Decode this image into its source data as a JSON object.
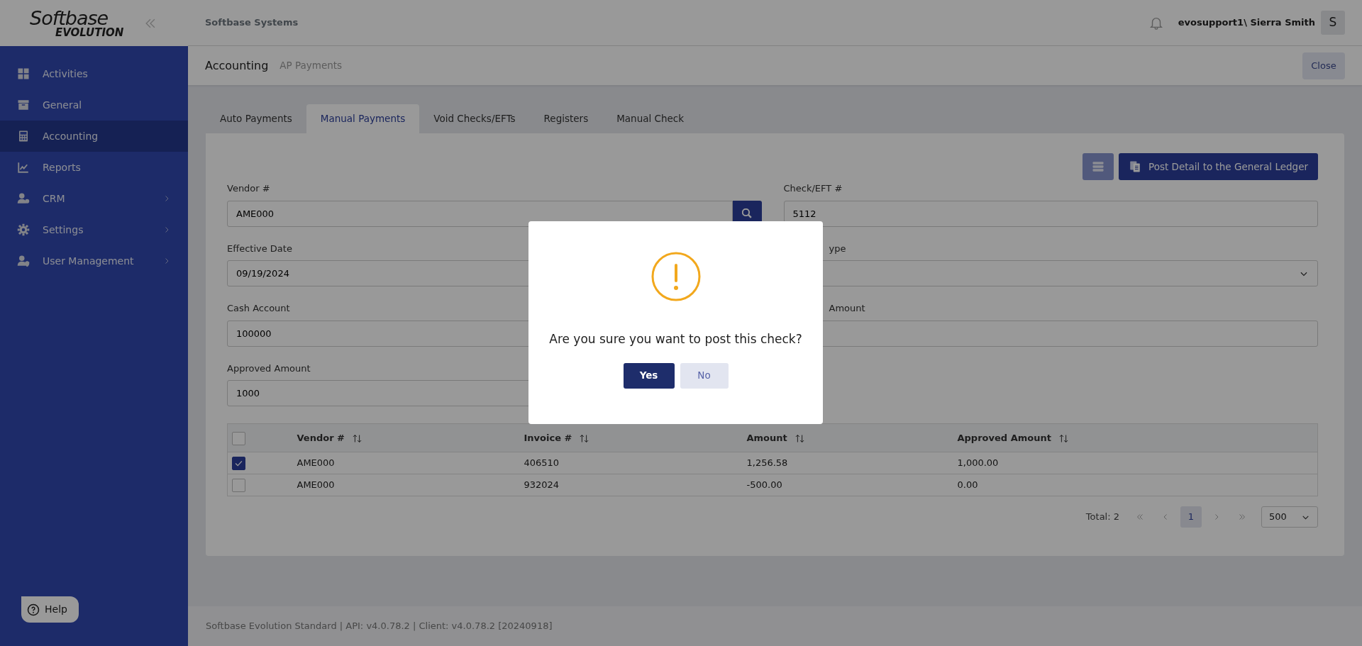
{
  "sidebar": {
    "logo": {
      "line_1": "Softbase",
      "line_2": "EVOLUTION"
    },
    "items": [
      {
        "label": "Activities",
        "selected": false,
        "expandable": false
      },
      {
        "label": "General",
        "selected": false,
        "expandable": false
      },
      {
        "label": "Accounting",
        "selected": true,
        "expandable": false
      },
      {
        "label": "Reports",
        "selected": false,
        "expandable": false
      },
      {
        "label": "CRM",
        "selected": false,
        "expandable": true
      },
      {
        "label": "Settings",
        "selected": false,
        "expandable": true
      },
      {
        "label": "User Management",
        "selected": false,
        "expandable": true
      }
    ],
    "help_button": "Help"
  },
  "header": {
    "company": "Softbase Systems",
    "user": "evosupport1\\ Sierra Smith",
    "avatar": "S"
  },
  "breadcrumb": {
    "title": "Accounting",
    "subtitle": "AP Payments",
    "close_button": "Close"
  },
  "tabs": [
    {
      "label": "Auto Payments",
      "selected": false
    },
    {
      "label": "Manual Payments",
      "selected": true
    },
    {
      "label": "Void Checks/EFTs",
      "selected": false
    },
    {
      "label": "Registers",
      "selected": false
    },
    {
      "label": "Manual Check",
      "selected": false
    }
  ],
  "toolbar": {
    "post_button": "Post Detail to the General Ledger"
  },
  "form": {
    "fields": [
      {
        "label": "Vendor #",
        "value": "AME000",
        "kind": "lookup"
      },
      {
        "label": "Check/EFT #",
        "value": "5112",
        "kind": "text"
      },
      {
        "label": "Effective Date",
        "value": "09/19/2024",
        "kind": "text"
      },
      {
        "label": "ype",
        "kind": "select",
        "partial": true
      },
      {
        "label": "Cash Account",
        "value": "100000",
        "kind": "text"
      },
      {
        "label": "Amount",
        "kind": "text",
        "partial": true
      },
      {
        "label": "Approved Amount",
        "value": "1000",
        "kind": "text"
      }
    ]
  },
  "table": {
    "select_all_checked": false,
    "columns": [
      "Vendor #",
      "Invoice #",
      "Amount",
      "Approved Amount"
    ],
    "rows": [
      {
        "checked": true,
        "cells": [
          "AME000",
          "406510",
          "1,256.58",
          "1,000.00"
        ]
      },
      {
        "checked": false,
        "cells": [
          "AME000",
          "932024",
          "-500.00",
          "0.00"
        ]
      }
    ]
  },
  "pagination": {
    "total": "Total: 2",
    "pages": [
      {
        "label": "1",
        "selected": true
      }
    ],
    "page_size": "500"
  },
  "footer": "Softbase Evolution Standard | API: v4.0.78.2 | Client: v4.0.78.2 [20240918]",
  "dialog": {
    "message": "Are you sure you want to post this check?",
    "yes_button": "Yes",
    "no_button": "No"
  }
}
